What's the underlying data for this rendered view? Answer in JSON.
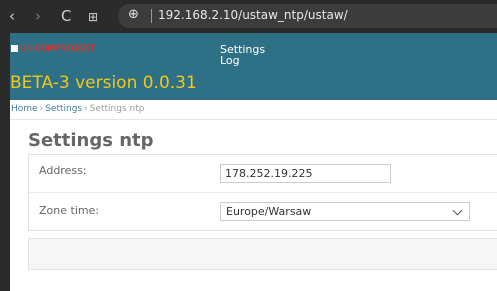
{
  "browser": {
    "back_glyph": "‹",
    "forward_glyph": "›",
    "reload_glyph": "C",
    "tabs_glyph": "⊞",
    "site_glyph": "⊕",
    "url": "192.168.2.10/ustaw_ntp/ustaw/"
  },
  "header": {
    "logo_text": "UNICOMPROJEKT",
    "menu": [
      "Settings",
      "Log"
    ],
    "version": "BETA-3 version 0.0.31",
    "background": "#2e7186",
    "version_color": "#f3c71b"
  },
  "breadcrumb": {
    "home": "Home",
    "settings": "Settings",
    "current": "Settings ntp",
    "sep": "›"
  },
  "form": {
    "title": "Settings ntp",
    "address_label": "Address:",
    "address_value": "178.252.19.225",
    "zone_label": "Zone time:",
    "zone_value": "Europe/Warsaw"
  }
}
